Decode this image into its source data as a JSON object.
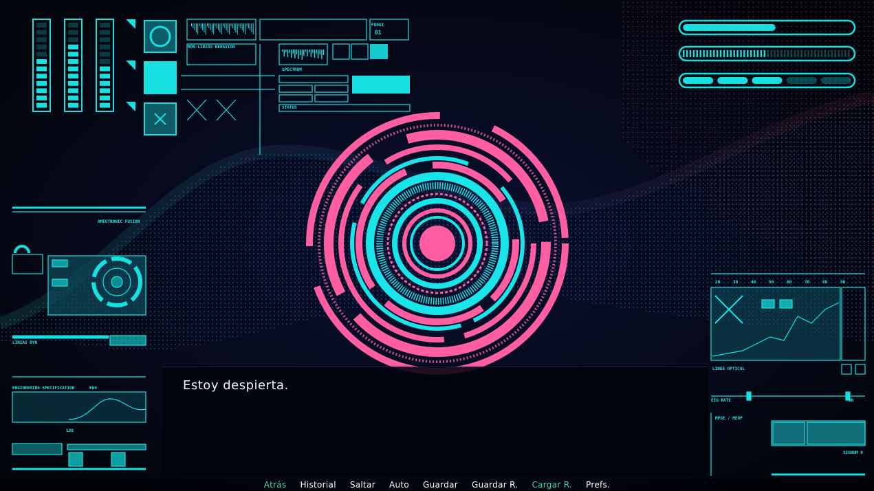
{
  "dialogue": {
    "text": "Estoy despierta."
  },
  "quick_menu": [
    {
      "label": "Atrás",
      "accent": true
    },
    {
      "label": "Historial",
      "accent": false
    },
    {
      "label": "Saltar",
      "accent": false
    },
    {
      "label": "Auto",
      "accent": false
    },
    {
      "label": "Guardar",
      "accent": false
    },
    {
      "label": "Guardar R.",
      "accent": false
    },
    {
      "label": "Cargar R.",
      "accent": true
    },
    {
      "label": "Prefs.",
      "accent": false
    }
  ],
  "hud": {
    "left_panel_1": "AMEUTRONIC FUSION",
    "left_panel_2": "LINIAS DYN",
    "left_panel_3": "ENGINEERING SPECIFICATION",
    "left_panel_3_code": "E04",
    "left_value": "138",
    "top_label_1": "MON-LINIAS BEHAVIOR",
    "top_label_2": "SPECTRUM",
    "top_label_3": "STATUS",
    "top_fungi": "FUNGI",
    "top_fungi_value": "01",
    "right_label_1": "LINEE OPTICAL",
    "right_label_2": "EEG RATE",
    "right_label_3": "MPGE / MEOP",
    "right_label_4": "SIGNUM 0",
    "right_tick_labels": [
      "20",
      "30",
      "40",
      "50",
      "60",
      "70",
      "80",
      "90"
    ],
    "right_small_on": "ON"
  },
  "status_bars": [
    {
      "name": "bar-1",
      "level": 0.55
    },
    {
      "name": "bar-2",
      "level": 0.5
    },
    {
      "name": "bar-3",
      "segments_on": 3,
      "segments_total": 5
    }
  ],
  "colors": {
    "cyan": "#16e0e0",
    "pink": "#ff5fa2",
    "accent_green": "#4fd1a6",
    "background": "#04060f"
  }
}
